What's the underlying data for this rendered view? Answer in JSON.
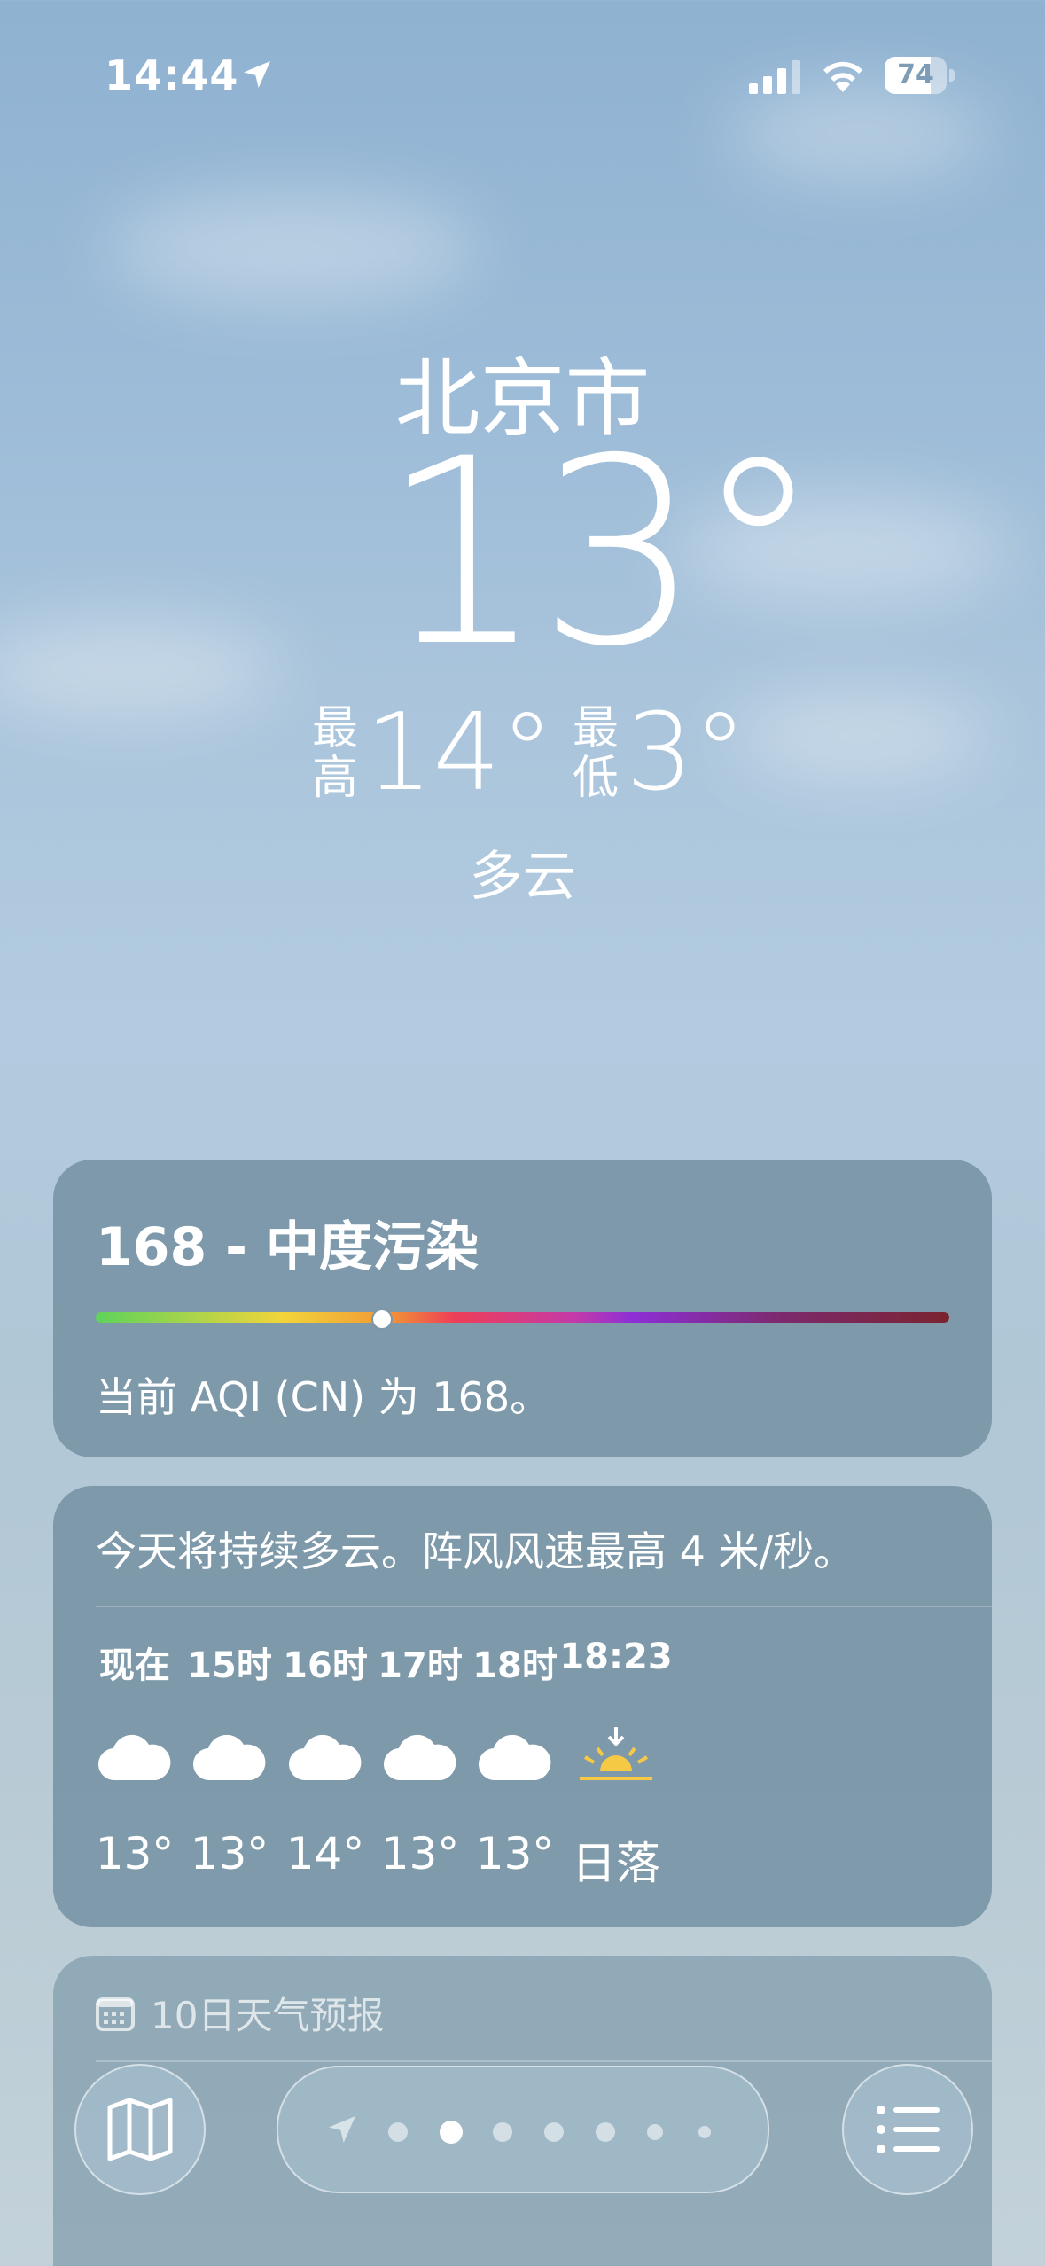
{
  "status_bar": {
    "time": "14:44",
    "battery": "74"
  },
  "header": {
    "city": "北京市",
    "temperature": "13°",
    "high_label": "最高",
    "high": "14°",
    "low_label": "最低",
    "low": "3°",
    "condition": "多云"
  },
  "aqi": {
    "title": "168 - 中度污染",
    "description": "当前 AQI (CN) 为 168。",
    "indicator_fraction": 0.335
  },
  "hourly": {
    "summary": "今天将持续多云。阵风风速最高 4 米/秒。",
    "items": [
      {
        "time": "现在",
        "icon": "cloud-icon",
        "temp": "13°"
      },
      {
        "time": "15时",
        "icon": "cloud-icon",
        "temp": "13°"
      },
      {
        "time": "16时",
        "icon": "cloud-icon",
        "temp": "14°"
      },
      {
        "time": "17时",
        "icon": "cloud-icon",
        "temp": "13°"
      },
      {
        "time": "18时",
        "icon": "cloud-icon",
        "temp": "13°"
      },
      {
        "time": "18:23",
        "icon": "sunset-icon",
        "temp": "日落"
      }
    ]
  },
  "ten_day": {
    "title": "10日天气预报"
  },
  "colors": {
    "sun": "#f6c945",
    "card_bg": "#6e8c9e"
  }
}
